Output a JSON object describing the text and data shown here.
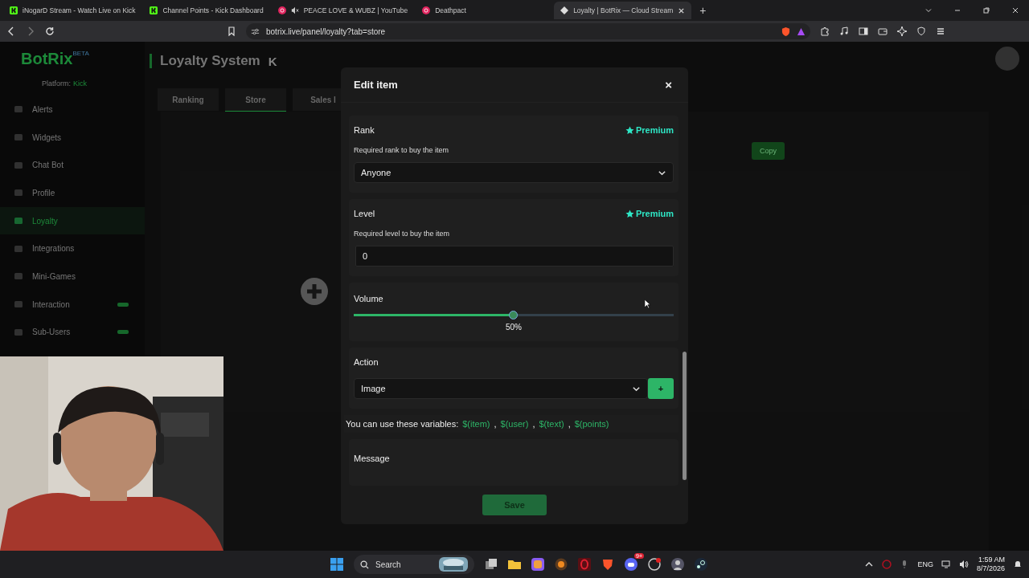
{
  "browser": {
    "tabs": [
      {
        "title": "iNogarD Stream - Watch Live on Kick",
        "kind": "kick",
        "muted": false,
        "selected": false
      },
      {
        "title": "Channel Points - Kick Dashboard",
        "kind": "kick",
        "muted": false,
        "selected": false
      },
      {
        "title": "PEACE LOVE & WUBZ | YouTube",
        "kind": "youtube",
        "muted": true,
        "selected": false
      },
      {
        "title": "Deathpact",
        "kind": "youtube",
        "muted": false,
        "selected": false
      },
      {
        "title": "Loyalty | BotRix — Cloud Stream",
        "kind": "botrix",
        "muted": false,
        "selected": true
      }
    ],
    "new_tab": "+",
    "url": "botrix.live/panel/loyalty?tab=store"
  },
  "app": {
    "logo": "BotRix",
    "logo_badge": "BETA",
    "platform_label": "Platform:",
    "platform_value": "Kick",
    "nav": [
      {
        "label": "Alerts",
        "selected": false,
        "badge": false
      },
      {
        "label": "Widgets",
        "selected": false,
        "badge": false
      },
      {
        "label": "Chat Bot",
        "selected": false,
        "badge": false
      },
      {
        "label": "Profile",
        "selected": false,
        "badge": false
      },
      {
        "label": "Loyalty",
        "selected": true,
        "badge": false
      },
      {
        "label": "Integrations",
        "selected": false,
        "badge": false
      },
      {
        "label": "Mini-Games",
        "selected": false,
        "badge": false
      },
      {
        "label": "Interaction",
        "selected": false,
        "badge": true
      },
      {
        "label": "Sub-Users",
        "selected": false,
        "badge": true
      }
    ],
    "page_title": "Loyalty System",
    "platform_letter": "K",
    "tabs": [
      {
        "label": "Ranking",
        "selected": false
      },
      {
        "label": "Store",
        "selected": true
      },
      {
        "label": "Sales l",
        "selected": false
      }
    ],
    "copy_button": "Copy"
  },
  "modal": {
    "title": "Edit item",
    "close": "×",
    "rank": {
      "label": "Rank",
      "premium": "Premium",
      "hint": "Required rank to buy the item",
      "value": "Anyone"
    },
    "level": {
      "label": "Level",
      "premium": "Premium",
      "hint": "Required level to buy the item",
      "value": "0"
    },
    "volume": {
      "label": "Volume",
      "level": 0.5,
      "reading": "50%"
    },
    "action": {
      "label": "Action",
      "value": "Image",
      "add": "+"
    },
    "variables_text": "You can use these variables:",
    "variables": [
      "$(item)",
      "$(user)",
      "$(text)",
      "$(points)"
    ],
    "variable_separator": ",",
    "message_label": "Message",
    "save": "Save"
  },
  "taskbar": {
    "search": "Search",
    "discord_badge": "9+",
    "language": "ENG",
    "time": "1:59 AM",
    "date": "8/7/2026"
  }
}
